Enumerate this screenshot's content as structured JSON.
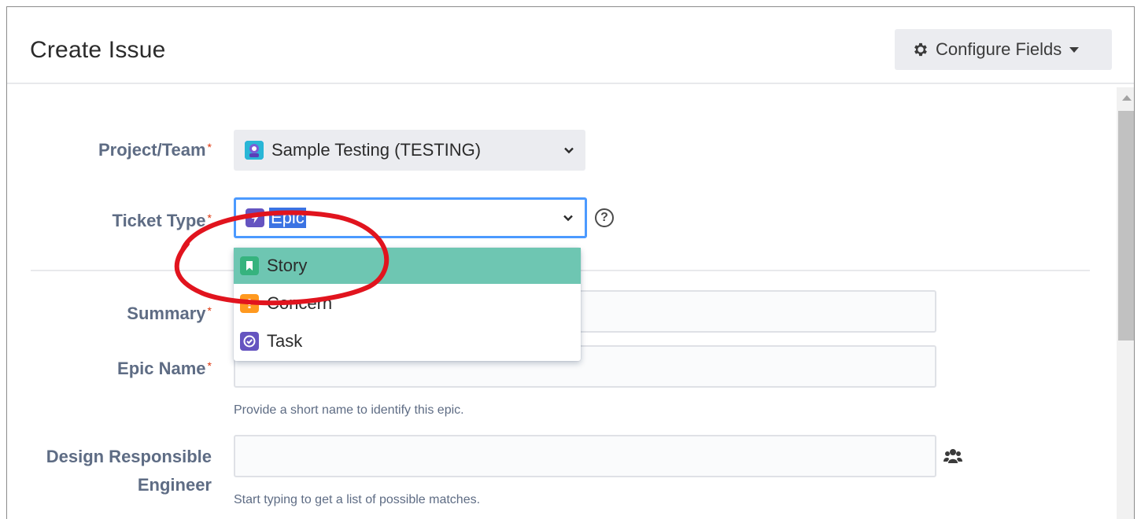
{
  "dialog": {
    "title": "Create Issue",
    "configure_label": "Configure Fields"
  },
  "form": {
    "project": {
      "label": "Project/Team",
      "required_mark": "*",
      "value": "Sample Testing (TESTING)"
    },
    "ticket_type": {
      "label": "Ticket Type",
      "required_mark": "*",
      "value": "Epic",
      "help": "?"
    },
    "summary": {
      "label": "Summary",
      "required_mark": "*",
      "value": ""
    },
    "epic_name": {
      "label": "Epic Name",
      "required_mark": "*",
      "value": "",
      "hint": "Provide a short name to identify this epic."
    },
    "design_engineer": {
      "label_line1": "Design Responsible",
      "label_line2": "Engineer",
      "value": "",
      "hint": "Start typing to get a list of possible matches."
    }
  },
  "dropdown": {
    "options": [
      {
        "label": "Story",
        "icon": "story-icon",
        "color": "#36b37e",
        "highlighted": true
      },
      {
        "label": "Concern",
        "icon": "concern-icon",
        "color": "#ff991f",
        "highlighted": false
      },
      {
        "label": "Task",
        "icon": "task-icon",
        "color": "#6554c0",
        "highlighted": false
      }
    ]
  },
  "colors": {
    "highlight": "#6ec6b2",
    "focus_border": "#4c9aff",
    "annotation": "#e1141e",
    "required": "#de350b"
  }
}
